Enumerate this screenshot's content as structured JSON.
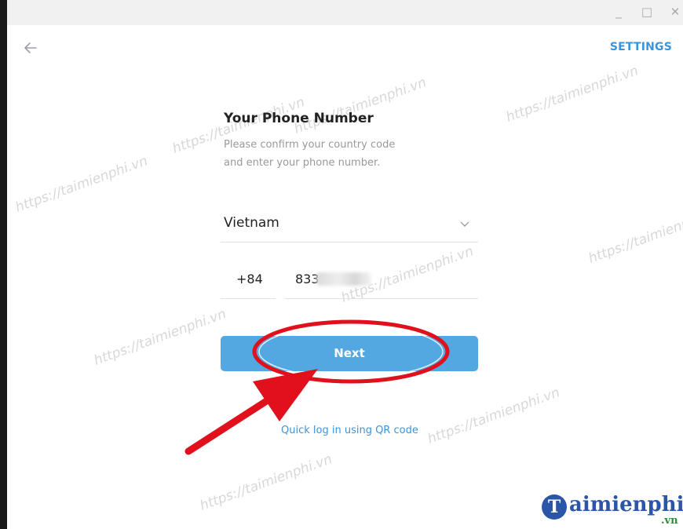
{
  "window": {
    "minimize": "_",
    "maximize": "□",
    "close": "✕"
  },
  "header": {
    "back_icon": "arrow-left-icon",
    "settings_label": "SETTINGS"
  },
  "login": {
    "title": "Your Phone Number",
    "description_line1": "Please confirm your country code",
    "description_line2": "and enter your phone number.",
    "country": "Vietnam",
    "country_code": "+84",
    "phone_number": "833",
    "next_label": "Next",
    "qr_link": "Quick log in using QR code"
  },
  "watermarks": [
    "https://taimienphi.vn",
    "https://taimienphi.vn",
    "https://taimienphi.vn",
    "https://taimienphi.vn",
    "https://taimienphi.vn",
    "https://taimienphi.vn",
    "https://taimienphi.vn",
    "https://taimienphi.vn",
    "https://taimienphi.vn"
  ],
  "logo": {
    "initial": "T",
    "text": "aimienphi",
    "suffix": ".vn"
  },
  "colors": {
    "accent": "#3b94d9",
    "button": "#54a8e2",
    "annotation": "#e0101c",
    "logo": "#2b55a8"
  }
}
